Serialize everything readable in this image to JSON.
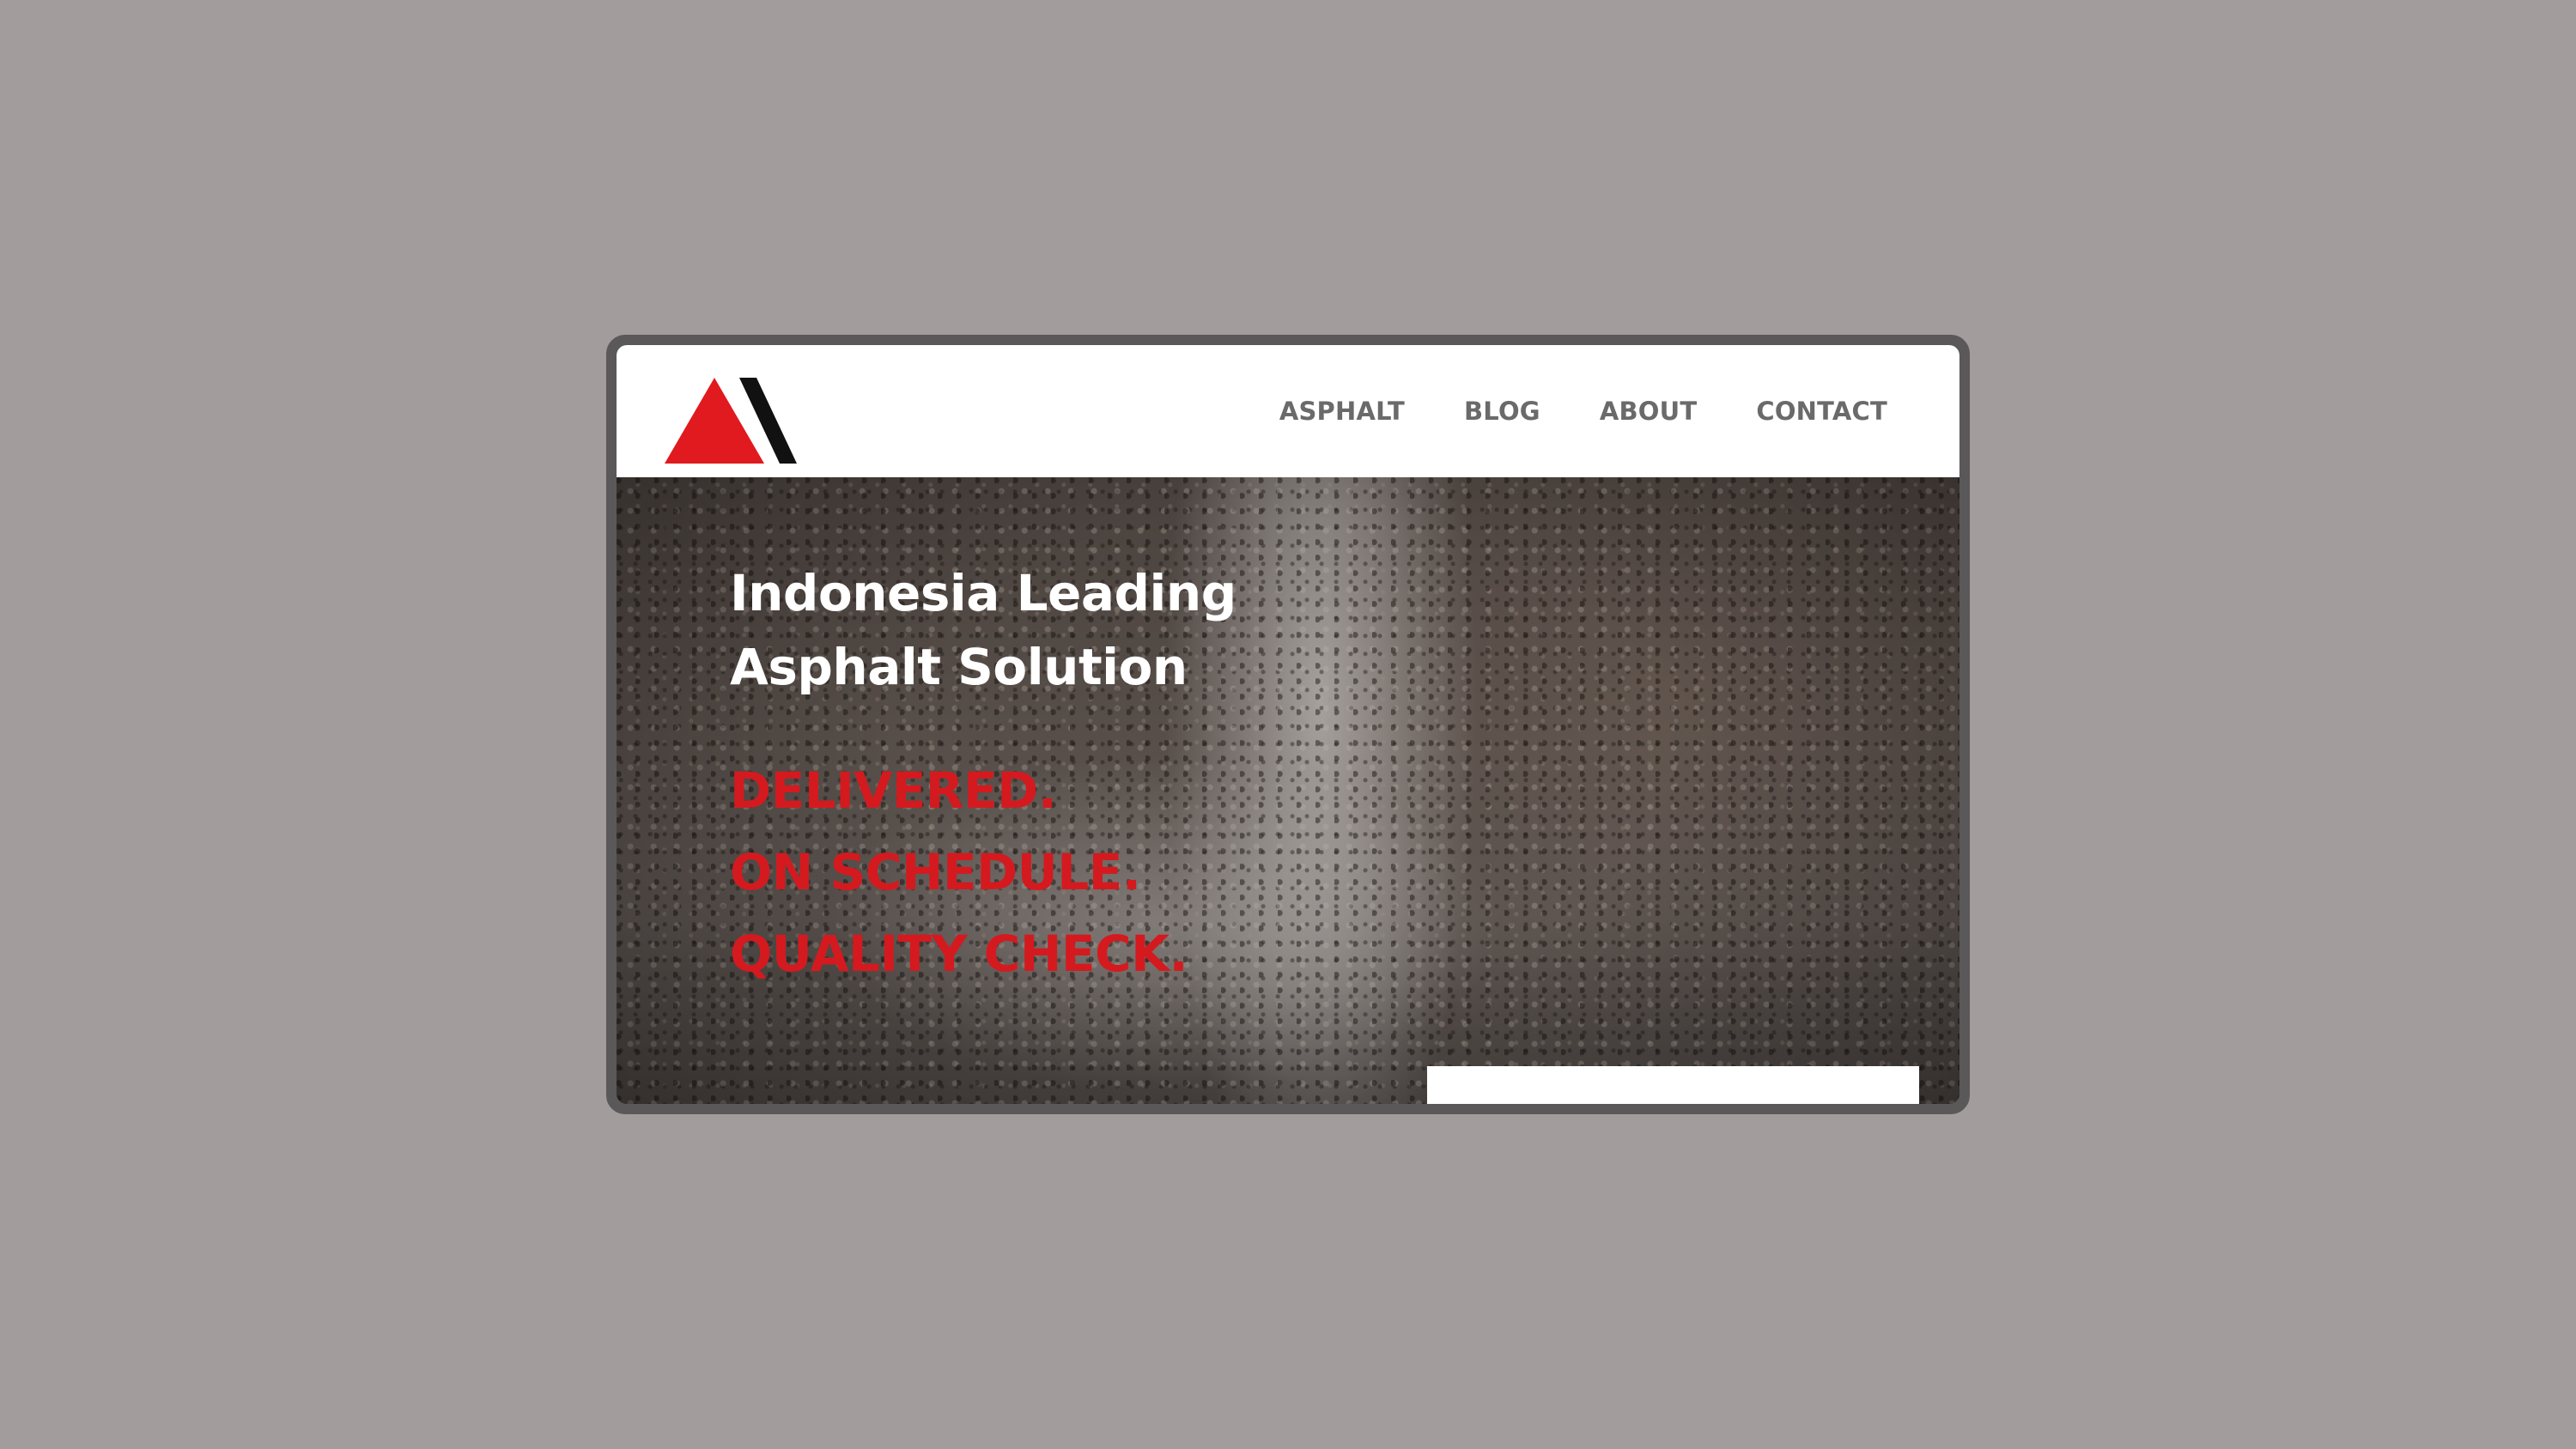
{
  "colors": {
    "background": "#a29c9c",
    "frame": "#5a5858",
    "header_bg": "#ffffff",
    "nav_text": "#6a6a6a",
    "hero_title": "#ffffff",
    "accent_red": "#d41a1f",
    "logo_black": "#111111"
  },
  "logo": {
    "icon": "triangle-logo-icon"
  },
  "nav": {
    "items": [
      {
        "label": "ASPHALT"
      },
      {
        "label": "BLOG"
      },
      {
        "label": "ABOUT"
      },
      {
        "label": "CONTACT"
      }
    ]
  },
  "hero": {
    "title_line1": "Indonesia Leading",
    "title_line2": "Asphalt Solution",
    "taglines": [
      "DELIVERED.",
      "ON SCHEDULE.",
      "QUALITY CHECK."
    ]
  }
}
